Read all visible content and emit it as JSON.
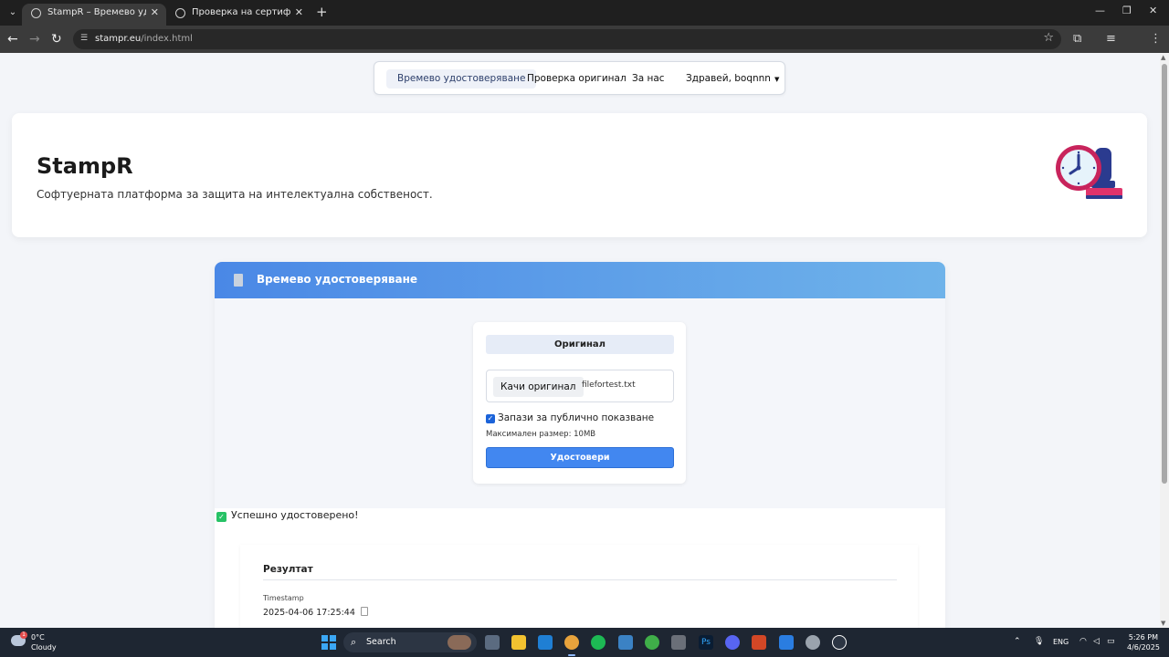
{
  "browser": {
    "tabs": [
      {
        "title": "StampR – Времево удостоверяване",
        "active": true
      },
      {
        "title": "Проверка на сертификат",
        "active": false
      }
    ],
    "url_domain": "stampr.eu",
    "url_path": "/index.html"
  },
  "nav": {
    "items": [
      {
        "label": "Времево удостоверяване",
        "active": true
      },
      {
        "label": "Проверка оригинал",
        "active": false
      },
      {
        "label": "За нас",
        "active": false
      },
      {
        "label": "Здравей, boqnnn",
        "active": false,
        "dropdown": true
      }
    ]
  },
  "hero": {
    "brand": "StampR",
    "tagline": "Софтуерната платформа за защита на интелектуална собственост."
  },
  "card": {
    "title": "Времево удостоверяване",
    "original_label": "Оригинал",
    "upload_button": "Качи оригинал",
    "file_name": "filefortest.txt",
    "public_checkbox_label": "Запази за публично показване",
    "public_checked": true,
    "max_size": "Максимален размер: 10MB",
    "submit_label": "Удостовери"
  },
  "status": {
    "success_message": "Успешно удостоверено!"
  },
  "result": {
    "title": "Резултат",
    "timestamp_label": "Timestamp",
    "timestamp_value": "2025-04-06 17:25:44"
  },
  "taskbar": {
    "weather_temp": "0°C",
    "weather_cond": "Cloudy",
    "weather_badge": "1",
    "search_placeholder": "Search",
    "language": "ENG",
    "time": "5:26 PM",
    "date": "4/6/2025"
  },
  "colors": {
    "accent": "#4287f0",
    "header_gradient_start": "#4a88e6",
    "header_gradient_end": "#6fb3ea",
    "success": "#27c266"
  }
}
